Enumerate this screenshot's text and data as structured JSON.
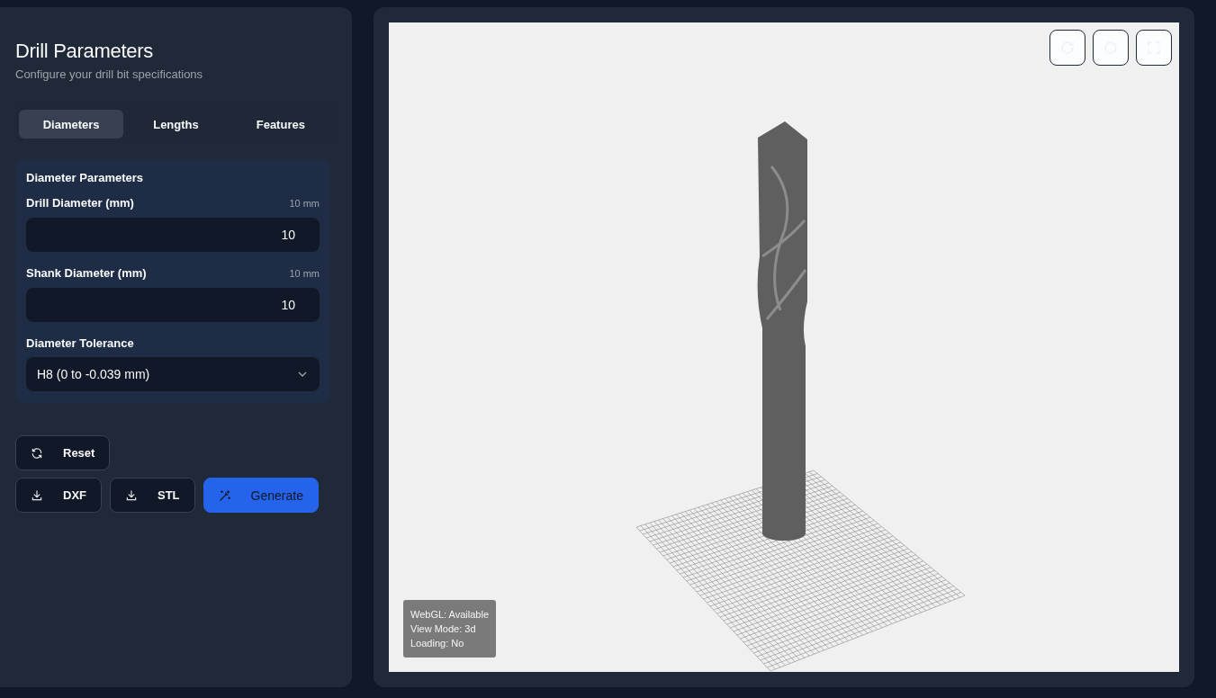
{
  "sidebar": {
    "title": "Drill Parameters",
    "subtitle": "Configure your drill bit specifications",
    "tabs": [
      {
        "label": "Diameters",
        "selected": true
      },
      {
        "label": "Lengths",
        "selected": false
      },
      {
        "label": "Features",
        "selected": false
      }
    ],
    "section": {
      "title": "Diameter Parameters",
      "fields": [
        {
          "kind": "number",
          "label": "Drill Diameter (mm)",
          "reading": "10 mm",
          "value": "10"
        },
        {
          "kind": "number",
          "label": "Shank Diameter (mm)",
          "reading": "10 mm",
          "value": "10"
        },
        {
          "kind": "select",
          "label": "Diameter Tolerance",
          "value": "H8 (0 to -0.039 mm)"
        }
      ]
    },
    "buttons": [
      {
        "kind": "reset",
        "label": "Reset"
      },
      {
        "kind": "download",
        "label": "DXF"
      },
      {
        "kind": "download",
        "label": "STL"
      },
      {
        "kind": "generate",
        "label": "Generate"
      }
    ]
  },
  "viewer": {
    "info": [
      "WebGL: Available",
      "View Mode: 3d",
      "Loading: No"
    ]
  }
}
